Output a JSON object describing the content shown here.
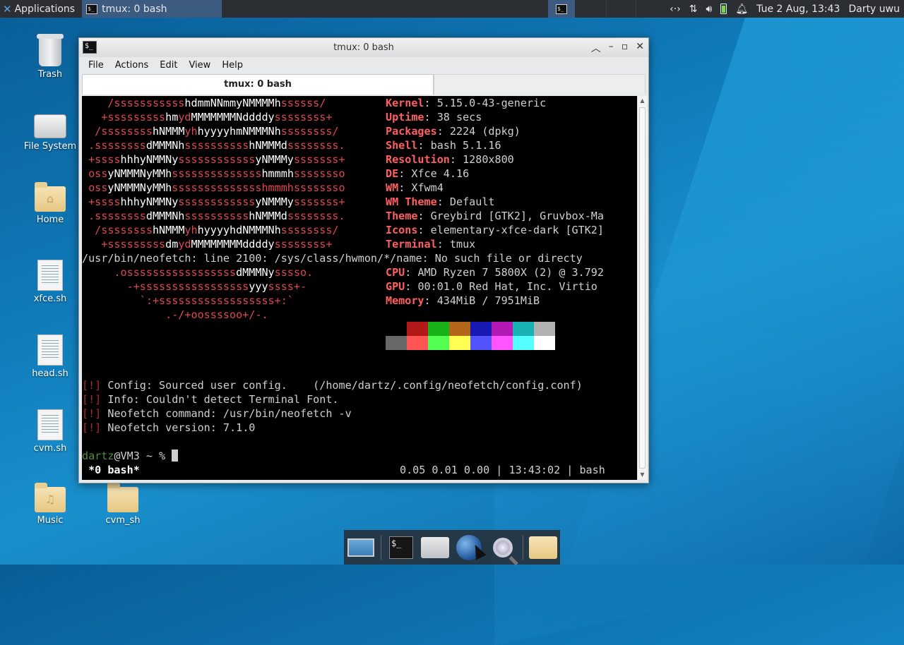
{
  "top_panel": {
    "applications_label": "Applications",
    "task_title": "tmux: 0 bash",
    "clock": "Tue  2 Aug, 13:43",
    "user": "Darty uwu",
    "icons": [
      "network-icon",
      "transfer-icon",
      "volume-icon",
      "battery-icon",
      "bell-icon"
    ]
  },
  "desktop_icons": [
    {
      "label": "Trash",
      "icon": "trash-icon"
    },
    {
      "label": "File System",
      "icon": "drive-icon"
    },
    {
      "label": "Home",
      "icon": "home-folder-icon"
    },
    {
      "label": "xfce.sh",
      "icon": "script-file-icon"
    },
    {
      "label": "head.sh",
      "icon": "script-file-icon"
    },
    {
      "label": "cvm.sh",
      "icon": "script-file-icon"
    },
    {
      "label": "Music",
      "icon": "music-folder-icon"
    },
    {
      "label": "cvm_sh",
      "icon": "folder-icon"
    }
  ],
  "window": {
    "title": "tmux: 0 bash",
    "menu": [
      "File",
      "Actions",
      "Edit",
      "View",
      "Help"
    ],
    "tab_label": "tmux: 0 bash"
  },
  "terminal": {
    "ascii": [
      [
        [
          "r",
          "    /sssssssssss"
        ],
        [
          "w",
          "hdmmNNmmyNMMMMh"
        ],
        [
          "r",
          "ssssss/"
        ]
      ],
      [
        [
          "r",
          "   +sssssssss"
        ],
        [
          "w",
          "hm"
        ],
        [
          "r",
          "yd"
        ],
        [
          "w",
          "MMMMMMMNddddy"
        ],
        [
          "r",
          "ssssssss+"
        ]
      ],
      [
        [
          "r",
          "  /ssssssss"
        ],
        [
          "w",
          "hNMMM"
        ],
        [
          "r",
          "yh"
        ],
        [
          "w",
          "hyyyyhmNMMMNh"
        ],
        [
          "r",
          "ssssssss/"
        ]
      ],
      [
        [
          "r",
          " .ssssssss"
        ],
        [
          "w",
          "dMMMNh"
        ],
        [
          "r",
          "ssssssssss"
        ],
        [
          "w",
          "hNMMMd"
        ],
        [
          "r",
          "ssssssss."
        ]
      ],
      [
        [
          "r",
          " +ssss"
        ],
        [
          "w",
          "hhhyNMMNy"
        ],
        [
          "r",
          "ssssssssssss"
        ],
        [
          "w",
          "yNMMMy"
        ],
        [
          "r",
          "sssssss+"
        ]
      ],
      [
        [
          "r",
          " oss"
        ],
        [
          "w",
          "yNMMMNyMMh"
        ],
        [
          "r",
          "ssssssssssssss"
        ],
        [
          "w",
          "hmmmh"
        ],
        [
          "r",
          "ssssssso"
        ]
      ],
      [
        [
          "r",
          " oss"
        ],
        [
          "w",
          "yNMMMNyMMh"
        ],
        [
          "r",
          "sssssssssssssshmmmh"
        ],
        [
          "r",
          "ssssssso"
        ]
      ],
      [
        [
          "r",
          " +ssss"
        ],
        [
          "w",
          "hhhyNMMNy"
        ],
        [
          "r",
          "ssssssssssss"
        ],
        [
          "w",
          "yNMMMy"
        ],
        [
          "r",
          "sssssss+"
        ]
      ],
      [
        [
          "r",
          " .ssssssss"
        ],
        [
          "w",
          "dMMMNh"
        ],
        [
          "r",
          "ssssssssss"
        ],
        [
          "w",
          "hNMMMd"
        ],
        [
          "r",
          "ssssssss."
        ]
      ],
      [
        [
          "r",
          "  /ssssssss"
        ],
        [
          "w",
          "hNMMM"
        ],
        [
          "r",
          "yh"
        ],
        [
          "w",
          "hyyyyhdNMMMNh"
        ],
        [
          "r",
          "ssssssss/"
        ]
      ],
      [
        [
          "r",
          "   +sssssssss"
        ],
        [
          "w",
          "dm"
        ],
        [
          "r",
          "yd"
        ],
        [
          "w",
          "MMMMMMMMddddy"
        ],
        [
          "r",
          "ssssssss+"
        ]
      ],
      [
        [
          "v",
          "/usr/bin/neofetch: line 2100: /sys/class/hwmon/*/name: No such file or directy"
        ]
      ],
      [
        [
          "r",
          "     .osssssssssssssssss"
        ],
        [
          "w",
          "dMMMNy"
        ],
        [
          "r",
          "sssso."
        ]
      ],
      [
        [
          "r",
          "       -+sssssssssssssssss"
        ],
        [
          "w",
          "yyy"
        ],
        [
          "r",
          "ssss+-"
        ]
      ],
      [
        [
          "r",
          "         `:+ssssssssssssssssss+:`"
        ]
      ],
      [
        [
          "r",
          "             .-/+oossssoo+/-."
        ]
      ]
    ],
    "info": [
      {
        "key": "Kernel",
        "value": "5.15.0-43-generic"
      },
      {
        "key": "Uptime",
        "value": "38 secs"
      },
      {
        "key": "Packages",
        "value": "2224 (dpkg)"
      },
      {
        "key": "Shell",
        "value": "bash 5.1.16"
      },
      {
        "key": "Resolution",
        "value": "1280x800"
      },
      {
        "key": "DE",
        "value": "Xfce 4.16"
      },
      {
        "key": "WM",
        "value": "Xfwm4"
      },
      {
        "key": "WM Theme",
        "value": "Default"
      },
      {
        "key": "Theme",
        "value": "Greybird [GTK2], Gruvbox-Ma"
      },
      {
        "key": "Icons",
        "value": "elementary-xfce-dark [GTK2]"
      },
      {
        "key": "Terminal",
        "value": "tmux"
      },
      {
        "key": "",
        "value": ""
      },
      {
        "key": "CPU",
        "value": "AMD Ryzen 7 5800X (2) @ 3.792"
      },
      {
        "key": "GPU",
        "value": "00:01.0 Red Hat, Inc. Virtio"
      },
      {
        "key": "Memory",
        "value": "434MiB / 7951MiB"
      }
    ],
    "palette": [
      "#000000",
      "#b21818",
      "#18b218",
      "#b26818",
      "#1818b2",
      "#b218b2",
      "#18b2b2",
      "#b2b2b2",
      "#686868",
      "#ff5454",
      "#54ff54",
      "#ffff54",
      "#5454ff",
      "#ff54ff",
      "#54ffff",
      "#ffffff"
    ],
    "messages": [
      "Config: Sourced user config.    (/home/dartz/.config/neofetch/config.conf)",
      "Info: Couldn't detect Terminal Font.",
      "Neofetch command: /usr/bin/neofetch -v",
      "Neofetch version: 7.1.0"
    ],
    "excl_mark": "[!]",
    "prompt_user": "dartz",
    "prompt_rest": "@VM3 ~ % ",
    "status_left": " *0 bash*",
    "status_right": "0.05 0.01 0.00 | 13:43:02 | bash"
  },
  "dock": [
    "show-desktop-icon",
    "terminal-icon",
    "file-manager-icon",
    "web-browser-icon",
    "app-finder-icon",
    "folder-icon"
  ]
}
